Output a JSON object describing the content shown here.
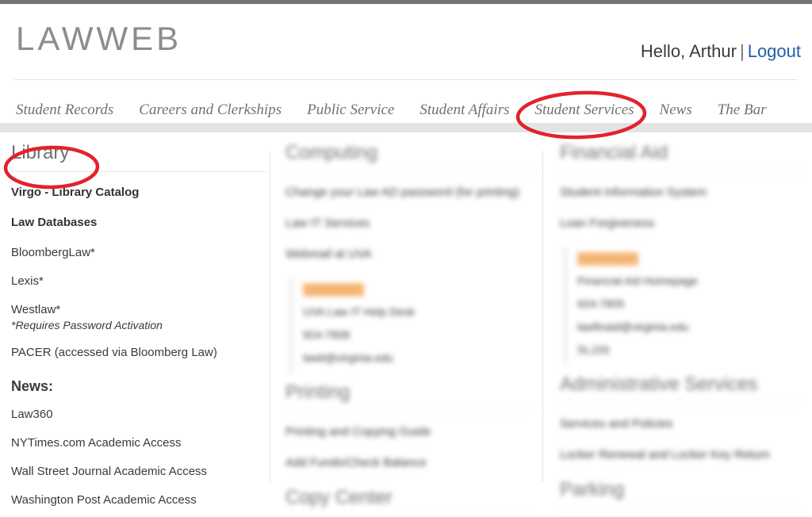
{
  "header": {
    "brand": "LAWWEB",
    "greeting": "Hello, Arthur",
    "separator": "|",
    "logout_label": "Logout",
    "logout_color": "#1f5fa8"
  },
  "nav": {
    "active_underline_color": "#e07b1e",
    "items": [
      {
        "label": "Student Records",
        "active": false
      },
      {
        "label": "Careers and Clerkships",
        "active": false
      },
      {
        "label": "Public Service",
        "active": false
      },
      {
        "label": "Student Affairs",
        "active": false
      },
      {
        "label": "Student Services",
        "active": true
      },
      {
        "label": "News",
        "active": false
      },
      {
        "label": "The Bar",
        "active": false
      }
    ]
  },
  "annotations": {
    "color": "#e1232b",
    "circled_tab": "Student Services",
    "circled_heading": "Library"
  },
  "columns": {
    "left": {
      "heading": "Library",
      "items": [
        {
          "text": "Virgo - Library Catalog",
          "style": "bold"
        },
        {
          "text": "Law Databases",
          "style": "bold"
        },
        {
          "text": "BloombergLaw*",
          "style": "link"
        },
        {
          "text": "Lexis*",
          "style": "link"
        },
        {
          "text": "Westlaw*",
          "style": "link-tight"
        },
        {
          "text": "*Requires Password Activation",
          "style": "italic"
        },
        {
          "text": "PACER (accessed via Bloomberg Law)",
          "style": "link"
        }
      ],
      "news_heading": "News:",
      "news_items": [
        "Law360",
        "NYTimes.com Academic Access",
        "Wall Street Journal Academic Access",
        "Washington Post Academic Access"
      ]
    },
    "middle": {
      "blurred": true,
      "sections": [
        {
          "heading": "Computing",
          "items": [
            "Change your Law AD password (for printing)",
            "Law IT Services",
            "Webmail at UVA"
          ],
          "contact": {
            "tag": "CONTACT",
            "lines": [
              "UVA Law IT Help Desk",
              "924-7808",
              "lawit@virginia.edu"
            ]
          }
        },
        {
          "heading": "Printing",
          "items": [
            "Printing and Copying Guide",
            "Add Funds/Check Balance"
          ]
        },
        {
          "heading": "Copy Center",
          "items": []
        }
      ]
    },
    "right": {
      "blurred": true,
      "sections": [
        {
          "heading": "Financial Aid",
          "items": [
            "Student Information System",
            "Loan Forgiveness"
          ],
          "contact": {
            "tag": "CONTACT",
            "lines": [
              "Financial Aid Homepage",
              "924-7805",
              "lawfinaid@virginia.edu",
              "SL155"
            ]
          }
        },
        {
          "heading": "Administrative Services",
          "items": [
            "Services and Policies",
            "Locker Renewal and Locker Key Return"
          ]
        },
        {
          "heading": "Parking",
          "items": []
        }
      ]
    }
  }
}
